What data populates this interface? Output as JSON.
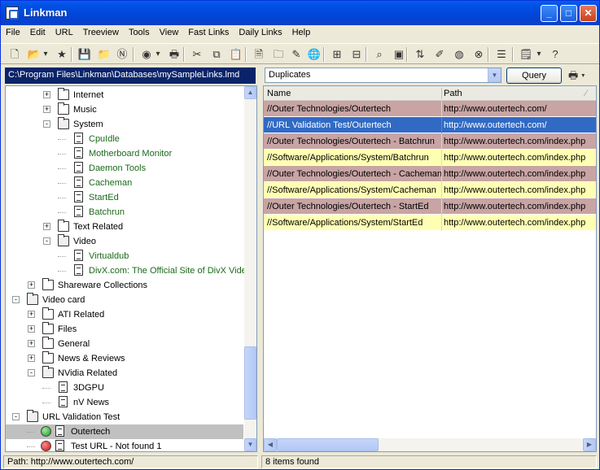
{
  "window": {
    "title": "Linkman"
  },
  "menu": [
    "File",
    "Edit",
    "URL",
    "Treeview",
    "Tools",
    "View",
    "Fast Links",
    "Daily Links",
    "Help"
  ],
  "toolbar": {
    "icons": [
      "new-file-icon",
      "open-folder-icon",
      "open-dropdown-icon",
      "star-folder-icon",
      "save-icon",
      "folder-icon",
      "n-icon",
      "browser-icon",
      "browser-dropdown-icon",
      "printer-icon",
      "cut-icon",
      "copy-icon",
      "paste-icon",
      "new-link-icon",
      "new-folder-icon",
      "edit-icon",
      "globe-icon",
      "expand-icon",
      "collapse-icon",
      "binoculars-icon",
      "screen-icon",
      "sort-az-icon",
      "marker-icon",
      "check-globe-icon",
      "stop-icon",
      "properties-icon",
      "notes-icon",
      "notes-dropdown-icon",
      "help-cursor-icon"
    ]
  },
  "pathbar": {
    "text": "C:\\Program Files\\Linkman\\Databases\\mySampleLinks.lmd"
  },
  "tree": {
    "items": [
      {
        "label": "Internet",
        "type": "folder",
        "level": 2,
        "expander": "+"
      },
      {
        "label": "Music",
        "type": "folder",
        "level": 2,
        "expander": "+"
      },
      {
        "label": "System",
        "type": "open-folder",
        "level": 2,
        "expander": "-"
      },
      {
        "label": "CpuIdle",
        "type": "link",
        "level": 3
      },
      {
        "label": "Motherboard Monitor",
        "type": "link",
        "level": 3
      },
      {
        "label": "Daemon Tools",
        "type": "link",
        "level": 3
      },
      {
        "label": "Cacheman",
        "type": "link",
        "level": 3
      },
      {
        "label": "StartEd",
        "type": "link",
        "level": 3
      },
      {
        "label": "Batchrun",
        "type": "link",
        "level": 3
      },
      {
        "label": "Text Related",
        "type": "folder",
        "level": 2,
        "expander": "+"
      },
      {
        "label": "Video",
        "type": "open-folder",
        "level": 2,
        "expander": "-"
      },
      {
        "label": "Virtualdub",
        "type": "link",
        "level": 3
      },
      {
        "label": "DivX.com: The Official Site of DivX Video",
        "type": "link",
        "level": 3
      },
      {
        "label": "Shareware Collections",
        "type": "folder",
        "level": 1,
        "expander": "+"
      },
      {
        "label": "Video card",
        "type": "open-folder",
        "level": 0,
        "expander": "-"
      },
      {
        "label": "ATI Related",
        "type": "folder",
        "level": 1,
        "expander": "+"
      },
      {
        "label": "Files",
        "type": "folder",
        "level": 1,
        "expander": "+"
      },
      {
        "label": "General",
        "type": "folder",
        "level": 1,
        "expander": "+"
      },
      {
        "label": "News & Reviews",
        "type": "folder",
        "level": 1,
        "expander": "+"
      },
      {
        "label": "NVidia Related",
        "type": "open-folder",
        "level": 1,
        "expander": "-"
      },
      {
        "label": "3DGPU",
        "type": "doc",
        "level": 2
      },
      {
        "label": "nV News",
        "type": "doc",
        "level": 2
      },
      {
        "label": "URL Validation Test",
        "type": "open-folder",
        "level": 0,
        "expander": "-"
      },
      {
        "label": "Outertech",
        "type": "status-ok",
        "level": 1,
        "selected": true
      },
      {
        "label": "Test URL - Not found 1",
        "type": "status-error",
        "level": 1
      }
    ]
  },
  "query": {
    "selected": "Duplicates",
    "button_label": "Query"
  },
  "list": {
    "columns": [
      "Name",
      "Path"
    ],
    "rows": [
      {
        "name": "//Outer Technologies/Outertech",
        "path": "http://www.outertech.com/",
        "color": "#C8A4A4"
      },
      {
        "name": "//URL Validation Test/Outertech",
        "path": "http://www.outertech.com/",
        "color": "#316AC5",
        "selected": true
      },
      {
        "name": "//Outer Technologies/Outertech - Batchrun",
        "path": "http://www.outertech.com/index.php",
        "color": "#C8A4A4"
      },
      {
        "name": "//Software/Applications/System/Batchrun",
        "path": "http://www.outertech.com/index.php",
        "color": "#FFFFB4"
      },
      {
        "name": "//Outer Technologies/Outertech - Cacheman",
        "path": "http://www.outertech.com/index.php",
        "color": "#C8A4A4"
      },
      {
        "name": "//Software/Applications/System/Cacheman",
        "path": "http://www.outertech.com/index.php",
        "color": "#FFFFB4"
      },
      {
        "name": "//Outer Technologies/Outertech - StartEd",
        "path": "http://www.outertech.com/index.php",
        "color": "#C8A4A4"
      },
      {
        "name": "//Software/Applications/System/StartEd",
        "path": "http://www.outertech.com/index.php",
        "color": "#FFFFB4"
      }
    ]
  },
  "status": {
    "path": "Path: http://www.outertech.com/",
    "count": "8 items found"
  }
}
